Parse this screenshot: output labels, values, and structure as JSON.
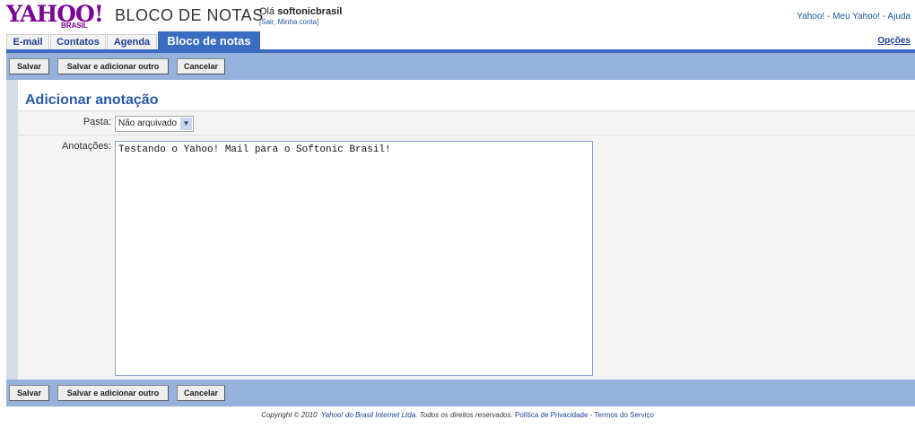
{
  "header": {
    "logo": "YAHOO!",
    "logo_sub": "BRASIL",
    "app_title": "BLOCO DE NOTAS",
    "greeting": "Olá",
    "username": "softonicbrasil",
    "signout": "Sair",
    "account": "Minha conta",
    "toplinks": [
      "Yahoo!",
      "Meu Yahoo!",
      "Ajuda"
    ],
    "options": "Opções"
  },
  "tabs": [
    {
      "label": "E-mail"
    },
    {
      "label": "Contatos"
    },
    {
      "label": "Agenda"
    },
    {
      "label": "Bloco de notas",
      "active": true
    }
  ],
  "toolbar": {
    "save": "Salvar",
    "save_add": "Salvar e adicionar outro",
    "cancel": "Cancelar"
  },
  "form": {
    "title": "Adicionar anotação",
    "folder_label": "Pasta:",
    "folder_value": "Não arquivado",
    "notes_label": "Anotações:",
    "notes_value": "Testando o Yahoo! Mail para o Softonic Brasil!"
  },
  "footer": {
    "copyright": "Copyright © 2010",
    "company": "Yahoo! do Brasil Internet Ltda.",
    "rights": "Todos os direitos reservados.",
    "privacy": "Política de Privacidade",
    "terms": "Termos do Serviço"
  },
  "colors": {
    "brand": "#7b0099",
    "accent": "#3a6cc0",
    "toolbar": "#95b1dc"
  }
}
